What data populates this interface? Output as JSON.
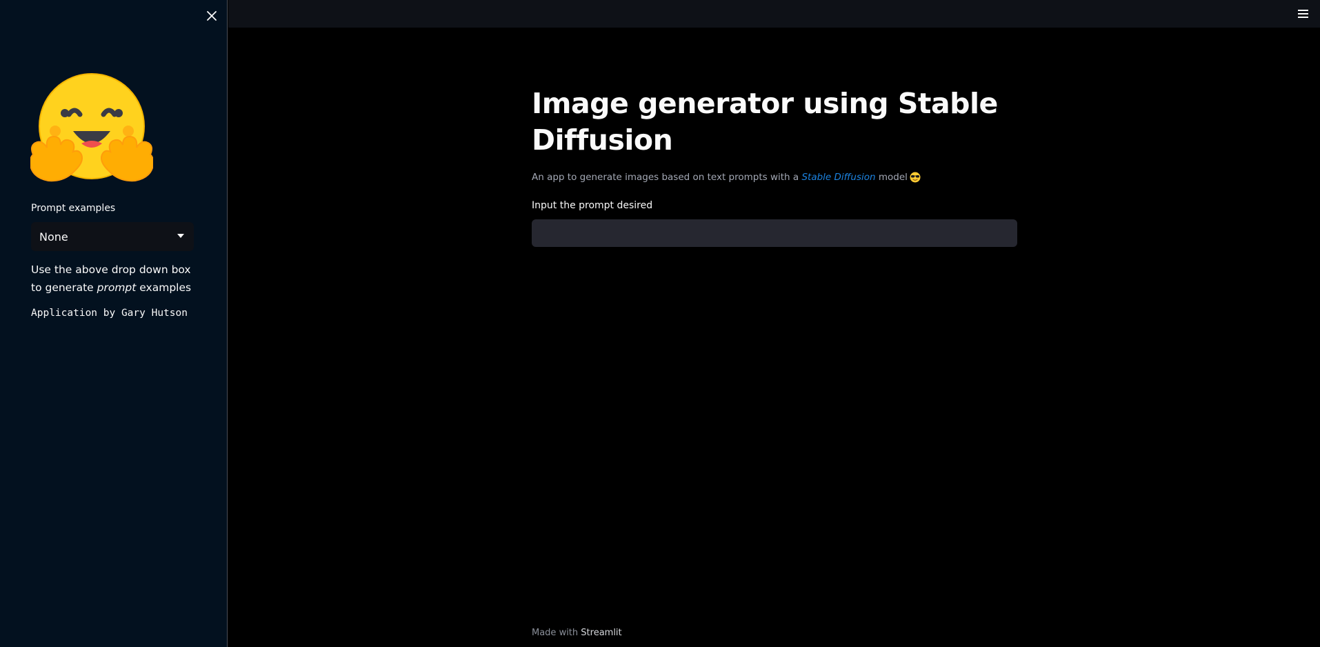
{
  "sidebar": {
    "logo_icon": "hugging-face-emoji",
    "prompt_label": "Prompt examples",
    "select_value": "None",
    "help_text_before": "Use the above drop down box to generate ",
    "help_text_em": "prompt",
    "help_text_after": " examples",
    "credit": "Application by Gary Hutson"
  },
  "main": {
    "title": "Image generator using Stable Diffusion",
    "subtitle_before": "An app to generate images based on text prompts with a ",
    "subtitle_link": "Stable Diffusion",
    "subtitle_after": " model",
    "subtitle_emoji": "sunglasses-emoji",
    "input_label": "Input the prompt desired",
    "input_value": ""
  },
  "footer": {
    "made_with": "Made with ",
    "brand": "Streamlit"
  },
  "colors": {
    "sidebar_bg": "#03111f",
    "main_bg": "#000000",
    "topbar_bg": "#0e1117",
    "input_bg": "#262730",
    "link": "#1c83e1",
    "logo_yellow": "#ffd21e",
    "logo_orange": "#ff9d0b"
  }
}
